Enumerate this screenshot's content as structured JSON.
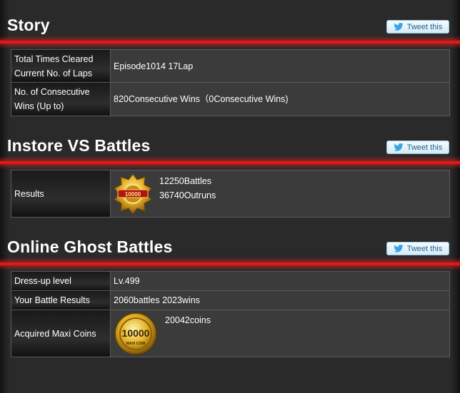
{
  "tweet_label": "Tweet this",
  "story": {
    "title": "Story",
    "rows": [
      {
        "label": "Total Times Cleared Current No. of Laps",
        "value": "Episode1014 17Lap"
      },
      {
        "label": "No. of Consecutive Wins (Up to)",
        "value": "820Consecutive Wins（0Consecutive Wins)"
      }
    ]
  },
  "instore": {
    "title": "Instore VS Battles",
    "results_label": "Results",
    "battles": "12250Battles",
    "outruns": "36740Outruns"
  },
  "online": {
    "title": "Online Ghost Battles",
    "rows": [
      {
        "label": "Dress-up level",
        "value": "Lv.499"
      },
      {
        "label": "Your Battle Results",
        "value": "2060battles 2023wins"
      }
    ],
    "coins_label": "Acquired Maxi Coins",
    "coins_value": "20042coins",
    "coin_badge_number": "10000",
    "coin_badge_text": "MAXI COIN"
  },
  "medal_text": "10000",
  "colors": {
    "accent_red": "#e01818",
    "tweet_text": "#2b5f86"
  }
}
